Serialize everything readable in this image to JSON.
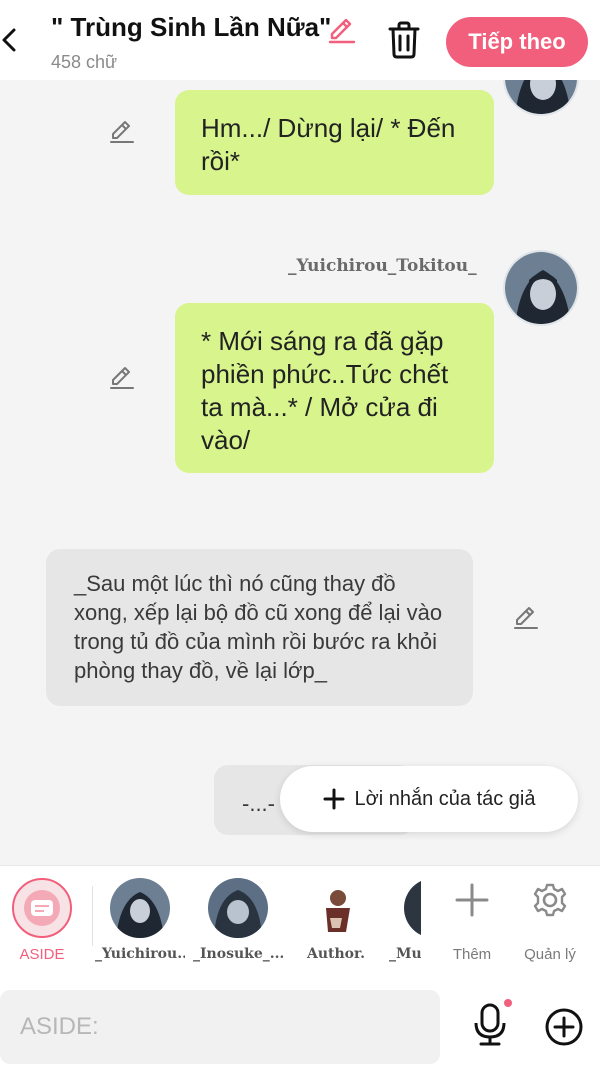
{
  "header": {
    "title": "\" Trùng Sinh Lần Nữa\"",
    "word_count": "458 chữ",
    "next_label": "Tiếp theo",
    "accent_color": "#f25f7c"
  },
  "messages": [
    {
      "type": "character",
      "text": "Hm.../ Dừng lại/ * Đến rồi*"
    },
    {
      "type": "character",
      "character_name": "_Yuichirou_Tokitou_",
      "text": "* Mới sáng ra đã gặp phiền phức..Tức chết ta mà...* / Mở cửa đi vào/"
    },
    {
      "type": "aside",
      "text": "_Sau một lúc thì nó cũng thay đồ xong, xếp lại bộ đồ cũ xong để lại vào trong tủ đồ của mình rồi bước ra khỏi phòng thay đồ, về lại lớp_"
    },
    {
      "type": "aside",
      "text": "-...-"
    }
  ],
  "author_note_label": "Lời nhắn của tác giả",
  "character_bar": {
    "items": [
      {
        "label": "ASIDE",
        "icon": "aside-icon"
      },
      {
        "label": "_Yuichirou..."
      },
      {
        "label": "_Inosuke_..."
      },
      {
        "label": "Author."
      },
      {
        "label": "_Mu"
      }
    ],
    "add_label": "Thêm",
    "manage_label": "Quản lý"
  },
  "input": {
    "placeholder": "ASIDE:"
  },
  "colors": {
    "green_bubble": "#d7f48d",
    "grey_bubble": "#e6e6e6",
    "mic_dot": "#f25f7c"
  }
}
